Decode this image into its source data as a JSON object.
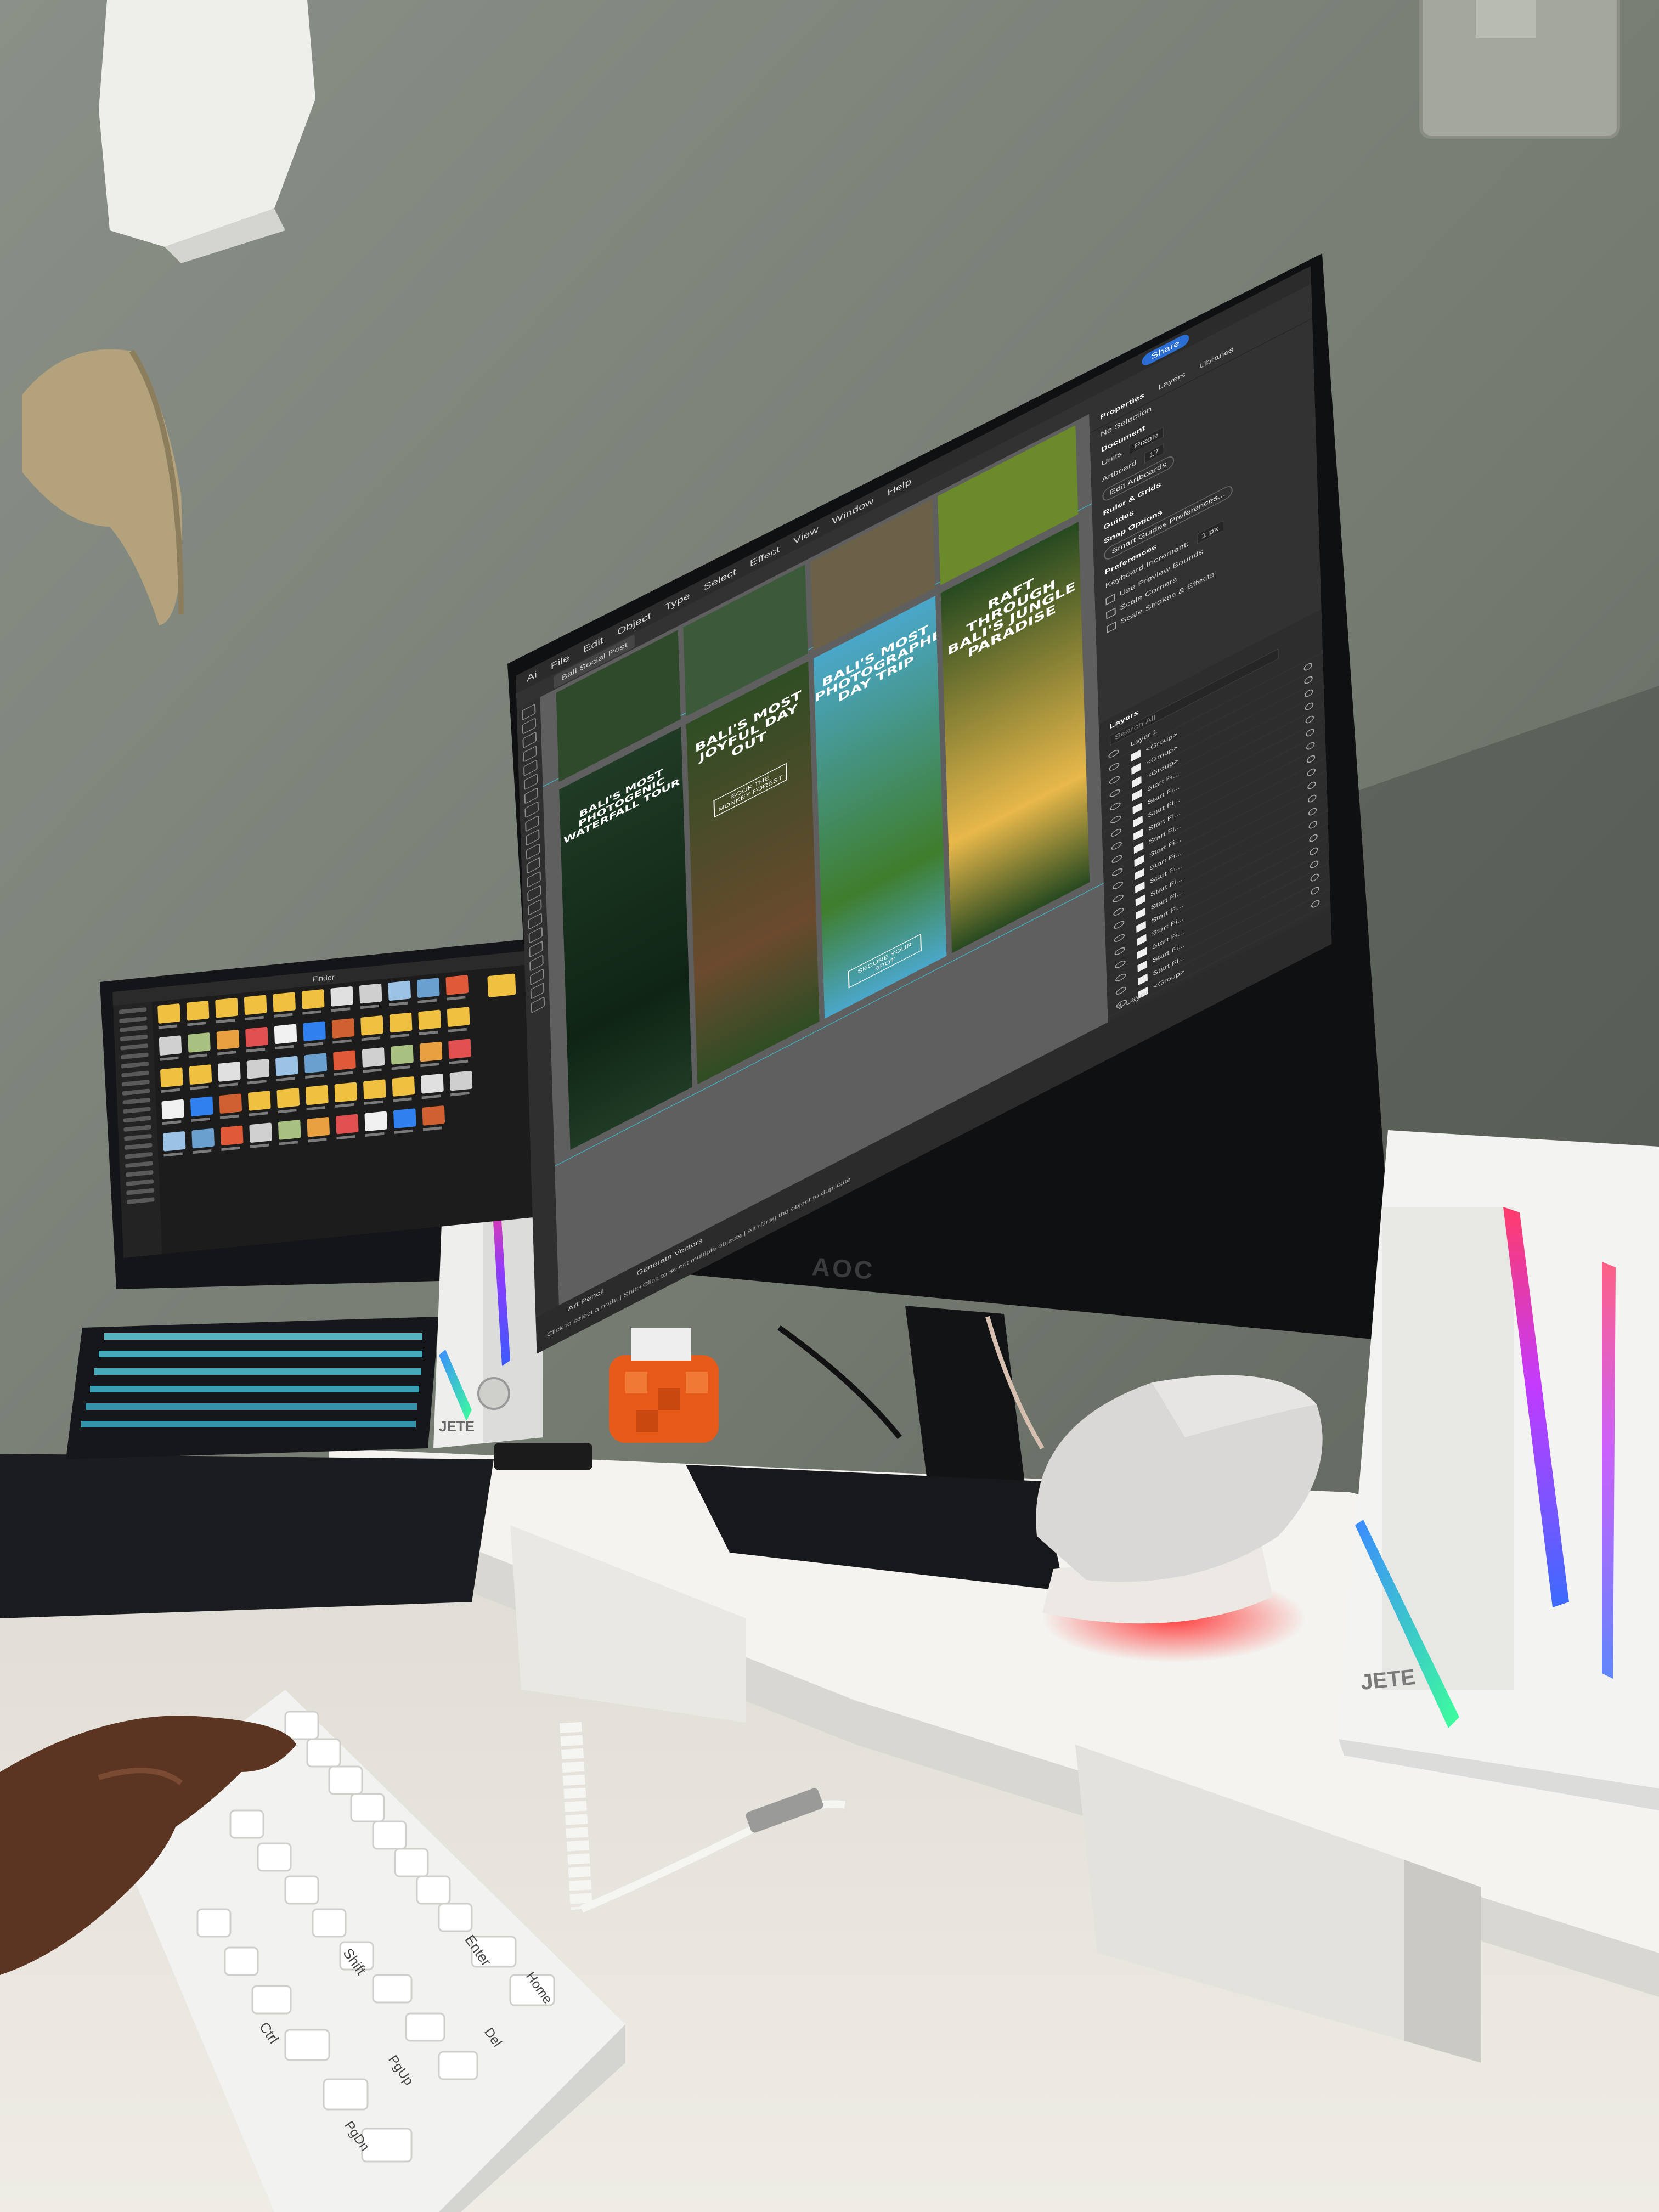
{
  "monitor": {
    "brand": "AOC",
    "app": {
      "menu": [
        "Ai",
        "File",
        "Edit",
        "Object",
        "Type",
        "Select",
        "Effect",
        "View",
        "Window",
        "Help"
      ],
      "share_label": "Share",
      "doc_tab": "Bali Social Post",
      "tools_count": 22,
      "artboards": [
        {
          "title": "BALI'S MOST PHOTOGENIC WATERFALL TOUR",
          "button": "",
          "bg": "#1f3a25",
          "accent": "#0f2415"
        },
        {
          "title": "BALI'S MOST JOYFUL DAY OUT",
          "button": "BOOK THE MONKEY FOREST",
          "bg": "#2f4d24",
          "accent": "#6b4a2e"
        },
        {
          "title": "BALI'S MOST PHOTOGRAPHED DAY TRIP",
          "button": "SECURE YOUR SPOT",
          "bg": "#4aa7c9",
          "accent": "#3f7d2c"
        },
        {
          "title": "RAFT THROUGH BALI'S JUNGLE PARADISE",
          "button": "",
          "bg": "#274a20",
          "accent": "#e8b84a"
        }
      ],
      "panel": {
        "tabs": [
          "Properties",
          "Layers",
          "Libraries"
        ],
        "no_selection": "No Selection",
        "document_label": "Document",
        "units_label": "Units",
        "units_value": "Pixels",
        "artboard_label": "Artboard",
        "artboard_value": "17",
        "edit_artboards": "Edit Artboards",
        "ruler_grid": "Ruler & Grids",
        "guides": "Guides",
        "snap_options": "Snap Options",
        "smart_guides_btn": "Smart Guides Preferences...",
        "preferences": "Preferences",
        "keyboard_increment": "Keyboard Increment:",
        "keyboard_increment_value": "1 px",
        "use_preview_bounds": "Use Preview Bounds",
        "scale_corners": "Scale Corners",
        "scale_strokes": "Scale Strokes & Effects",
        "layers_title": "Layers",
        "search_placeholder": "Search All",
        "layer_1": "Layer 1",
        "layer_rows": [
          "<Group>",
          "<Group>",
          "<Group>",
          "Start Fi...",
          "Start Fi...",
          "Start Fi...",
          "Start Fi...",
          "Start Fi...",
          "Start Fi...",
          "Start Fi...",
          "Start Fi...",
          "Start Fi...",
          "Start Fi...",
          "Start Fi...",
          "Start Fi...",
          "Start Fi...",
          "Start Fi...",
          "Start Fi...",
          "<Group>"
        ],
        "layers_count": "1 Layer"
      },
      "status": {
        "tool1": "Art Pencil",
        "tool2": "Generate Vectors",
        "hint": "Click to select a node | Shift+Click to select multiple objects | Alt+Drag the object to duplicate"
      }
    }
  },
  "laptop": {
    "window_title": "Finder"
  },
  "speakers": {
    "brand": "JETE"
  },
  "keyboard": {
    "keys_visible": [
      "Shift",
      "Enter",
      "Ctrl",
      "PgDn",
      "PgUp",
      "Home",
      "Del"
    ]
  },
  "colors": {
    "wall": "#7d8378",
    "desk": "#e6e3dd",
    "shelf": "#f1f0ec",
    "rgb_blue": "#4b4bff",
    "rgb_magenta": "#ff3b8d",
    "rgb_green": "#3dff9a",
    "rgb_red": "#ff2a2a"
  }
}
